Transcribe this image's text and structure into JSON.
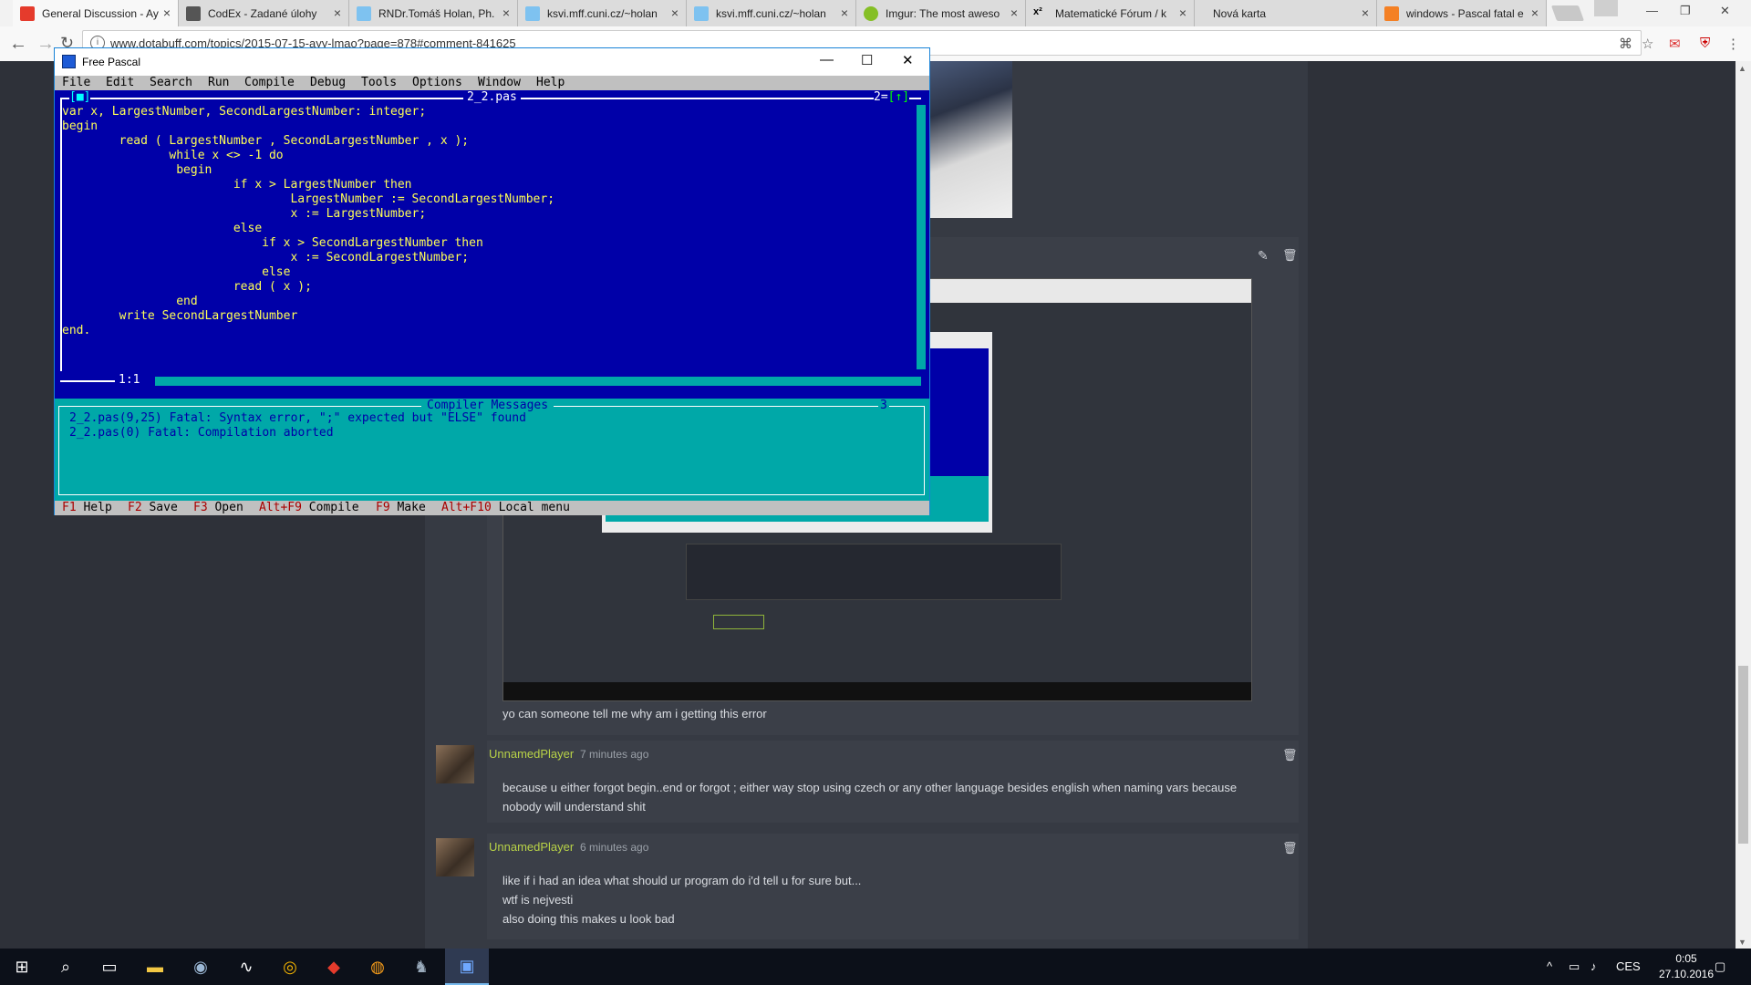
{
  "browser": {
    "tabs": [
      {
        "title": "General Discussion - Ay",
        "icon": "dotabuff-icon",
        "color": "#e53b2c"
      },
      {
        "title": "CodEx - Zadané úlohy",
        "icon": "codex-icon",
        "color": "#555555"
      },
      {
        "title": "RNDr.Tomáš Holan, Ph.",
        "icon": "page-icon",
        "color": "#7ec2f0"
      },
      {
        "title": "ksvi.mff.cuni.cz/~holan",
        "icon": "page-icon",
        "color": "#7ec2f0"
      },
      {
        "title": "ksvi.mff.cuni.cz/~holan",
        "icon": "page-icon",
        "color": "#7ec2f0"
      },
      {
        "title": "Imgur: The most aweso",
        "icon": "imgur-icon",
        "color": "#85bf25"
      },
      {
        "title": "Matematické Fórum / k",
        "icon": "x2-icon",
        "color": "#333333"
      },
      {
        "title": "Nová karta",
        "icon": "",
        "color": ""
      },
      {
        "title": "windows - Pascal fatal e",
        "icon": "stackoverflow-icon",
        "color": "#f48024"
      }
    ],
    "url": "www.dotabuff.com/topics/2015-07-15-ayy-lmao?page=878#comment-841625",
    "window_controls": {
      "minimize": "—",
      "restore": "❐",
      "close": "✕"
    }
  },
  "freepascal": {
    "title": "Free Pascal",
    "menu": [
      "File",
      "Edit",
      "Search",
      "Run",
      "Compile",
      "Debug",
      "Tools",
      "Options",
      "Window",
      "Help"
    ],
    "editor": {
      "filename": "2_2.pas",
      "window_number": "2",
      "cursor": "1:1",
      "code": [
        "var x, LargestNumber, SecondLargestNumber: integer;",
        "begin",
        "        read ( LargestNumber , SecondLargestNumber , x );",
        "               while x <> -1 do",
        "                begin",
        "                        if x > LargestNumber then",
        "                                LargestNumber := SecondLargestNumber;",
        "                                x := LargestNumber;",
        "                        else",
        "                            if x > SecondLargestNumber then",
        "                                x := SecondLargestNumber;",
        "                            else",
        "                        read ( x );",
        "                end",
        "        write SecondLargestNumber",
        "end."
      ]
    },
    "messages": {
      "title": "Compiler Messages",
      "window_number": "3",
      "lines": [
        "2_2.pas(9,25) Fatal: Syntax error, \";\" expected but \"ELSE\" found",
        "2_2.pas(0) Fatal: Compilation aborted"
      ]
    },
    "status": [
      {
        "key": "F1",
        "label": "Help"
      },
      {
        "key": "F2",
        "label": "Save"
      },
      {
        "key": "F3",
        "label": "Open"
      },
      {
        "key": "Alt+F9",
        "label": "Compile"
      },
      {
        "key": "F9",
        "label": "Make"
      },
      {
        "key": "Alt+F10",
        "label": "Local menu"
      }
    ]
  },
  "comments": {
    "first_text": "yo can someone tell me why am i getting this error",
    "items": [
      {
        "author": "UnnamedPlayer",
        "time": "7 minutes ago",
        "lines": [
          "because u either forgot begin..end or forgot ; either way stop using czech or any other language besides english when naming vars because",
          "nobody will understand shit"
        ]
      },
      {
        "author": "UnnamedPlayer",
        "time": "6 minutes ago",
        "lines": [
          "like if i had an idea what should ur program do i'd tell u for sure but...",
          "wtf is nejvesti",
          "also doing this makes u look bad"
        ]
      }
    ]
  },
  "taskbar": {
    "language": "CES",
    "time": "0:05",
    "date": "27.10.2016"
  }
}
